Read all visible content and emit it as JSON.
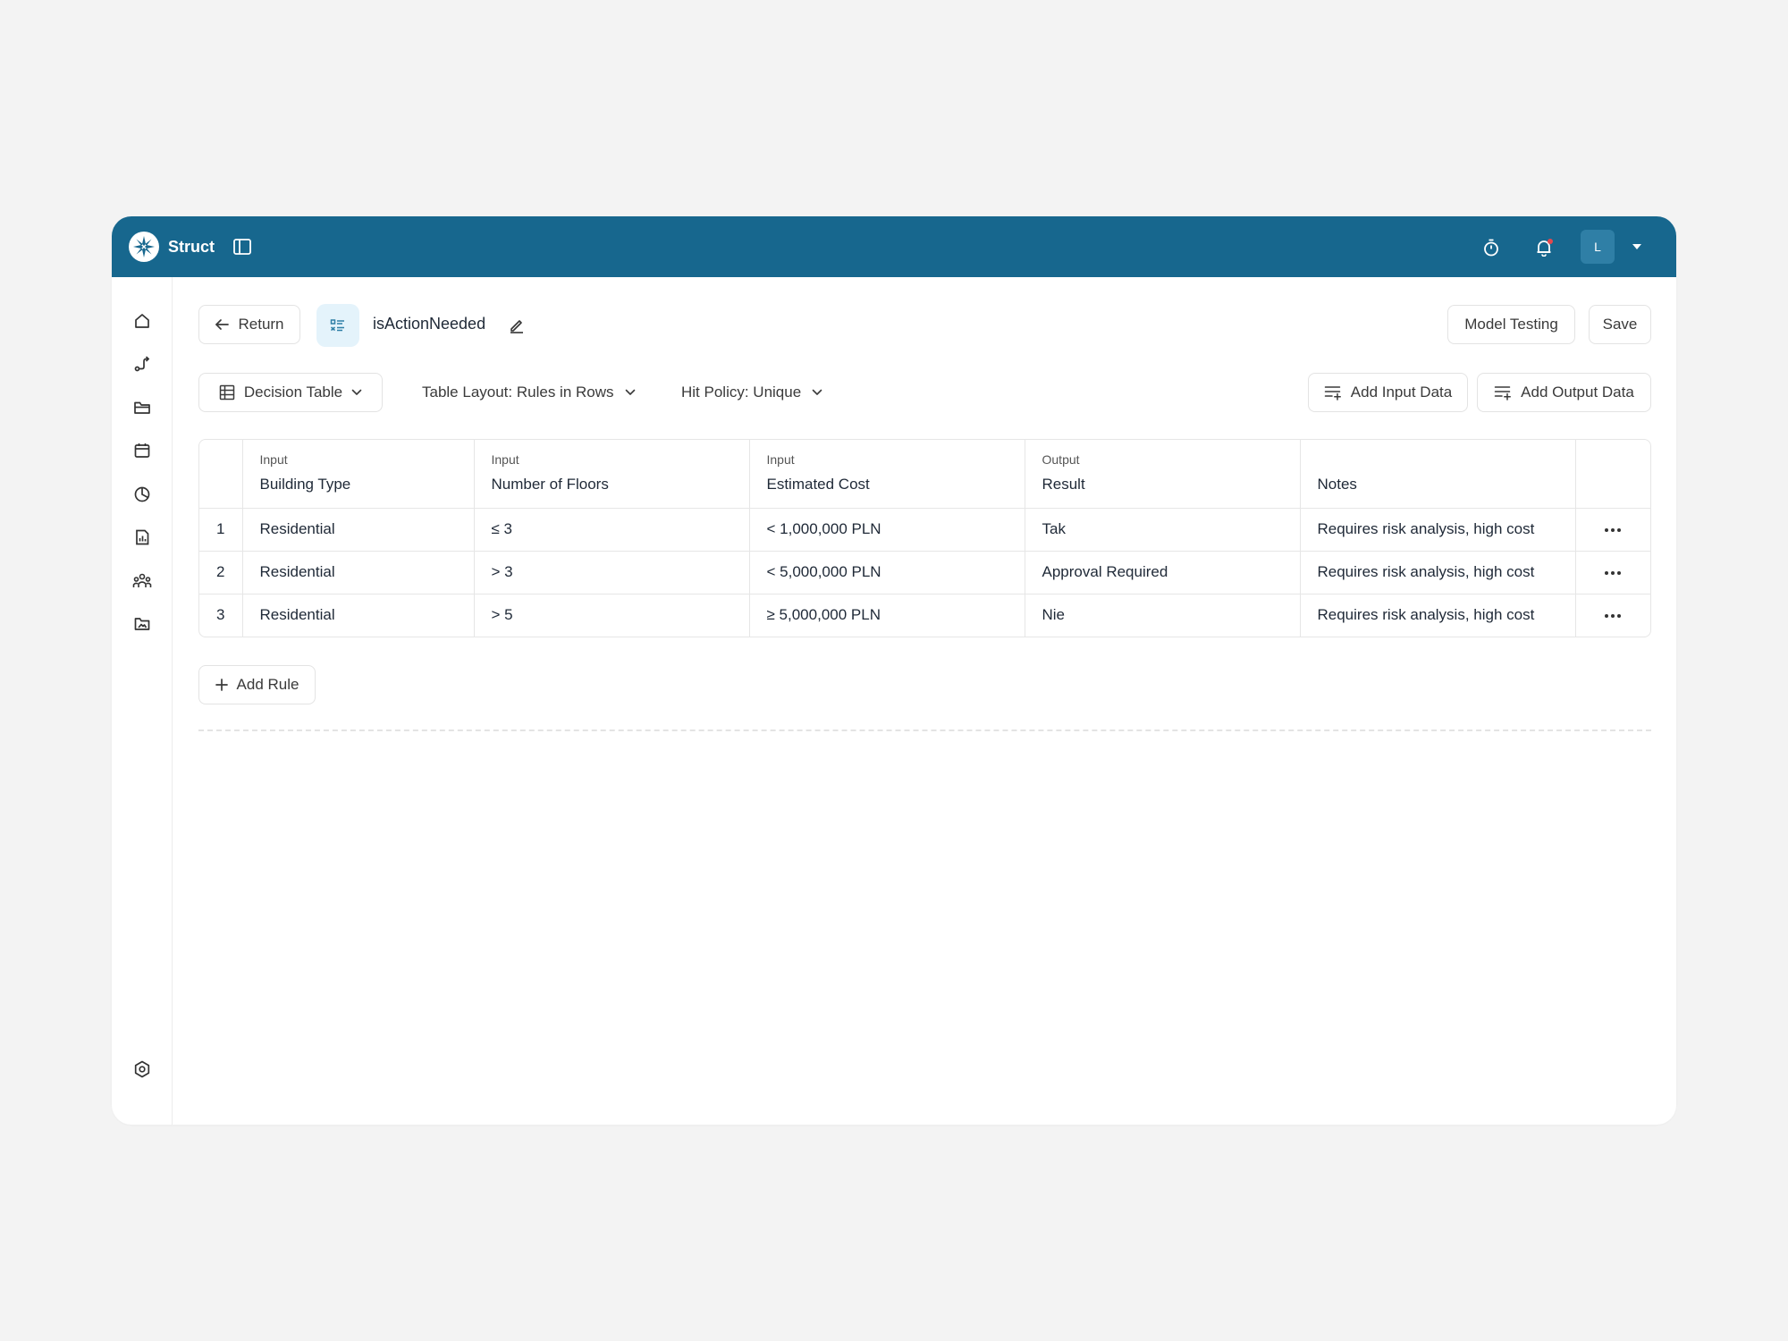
{
  "app": {
    "name": "Struct",
    "avatar_initial": "L"
  },
  "colors": {
    "topbar": "#17678e",
    "avatar": "#2f7fa6",
    "notification_dot": "#e5484d",
    "model_icon_bg": "#e4f3fb"
  },
  "toolbar": {
    "return_label": "Return",
    "model_name": "isActionNeeded",
    "model_testing_label": "Model Testing",
    "save_label": "Save"
  },
  "options": {
    "decision_table_label": "Decision Table",
    "table_layout_label": "Table Layout: Rules in Rows",
    "hit_policy_label": "Hit Policy: Unique",
    "add_input_label": "Add Input Data",
    "add_output_label": "Add Output Data"
  },
  "table": {
    "columns": [
      {
        "kind": "Input",
        "name": "Building Type"
      },
      {
        "kind": "Input",
        "name": "Number of Floors"
      },
      {
        "kind": "Input",
        "name": "Estimated Cost"
      },
      {
        "kind": "Output",
        "name": "Result"
      },
      {
        "kind": "",
        "name": "Notes"
      }
    ],
    "rows": [
      {
        "num": "1",
        "building": "Residential",
        "floors": "≤ 3",
        "cost": "< 1,000,000 PLN",
        "result": "Tak",
        "notes": "Requires risk analysis, high cost"
      },
      {
        "num": "2",
        "building": "Residential",
        "floors": "> 3",
        "cost": "< 5,000,000 PLN",
        "result": "Approval Required",
        "notes": "Requires risk analysis, high cost"
      },
      {
        "num": "3",
        "building": "Residential",
        "floors": "> 5",
        "cost": "≥ 5,000,000 PLN",
        "result": "Nie",
        "notes": "Requires risk analysis, high cost"
      }
    ]
  },
  "add_rule_label": "Add Rule",
  "nav_icons": [
    "home-icon",
    "workflow-icon",
    "folder-icon",
    "calendar-icon",
    "pie-chart-icon",
    "report-icon",
    "team-icon",
    "image-folder-icon",
    "settings-icon"
  ]
}
